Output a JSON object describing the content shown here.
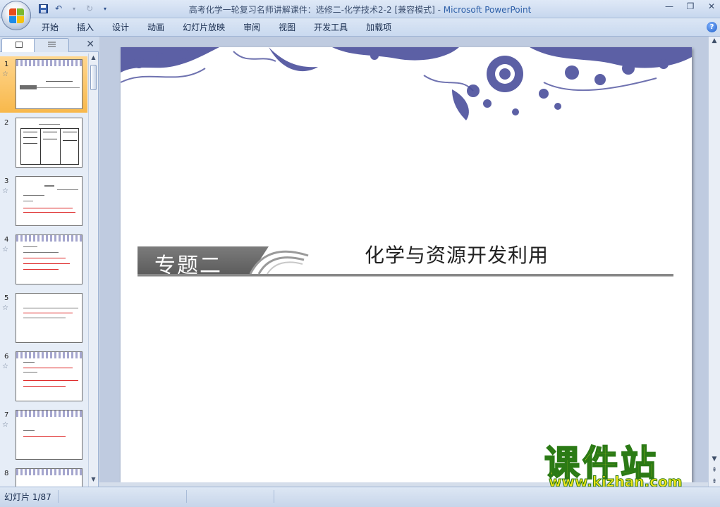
{
  "window": {
    "title": "高考化学一轮复习名师讲解课件：选修二-化学技术2-2 [兼容模式]",
    "title_sep": " - ",
    "app_name": "Microsoft PowerPoint"
  },
  "ribbon": {
    "tabs": [
      "开始",
      "插入",
      "设计",
      "动画",
      "幻灯片放映",
      "审阅",
      "视图",
      "开发工具",
      "加载项"
    ]
  },
  "slide_panel": {
    "close_glyph": "✕",
    "thumbnails": [
      {
        "number": "1",
        "active": true
      },
      {
        "number": "2",
        "active": false
      },
      {
        "number": "3",
        "active": false
      },
      {
        "number": "4",
        "active": false
      },
      {
        "number": "5",
        "active": false
      },
      {
        "number": "6",
        "active": false
      },
      {
        "number": "7",
        "active": false
      },
      {
        "number": "8",
        "active": false
      }
    ],
    "transition_marker": "☆"
  },
  "slide": {
    "banner_label": "专题二",
    "title": "化学与资源开发利用"
  },
  "watermark": {
    "name": "课件站",
    "url": "www.kjzhan.com"
  },
  "status": {
    "slide_indicator": "幻灯片 1/87"
  },
  "colors": {
    "accent": "#2d5fa8",
    "floral": "#4b4f9c",
    "banner": "#6d6d6d",
    "active_thumb": "#f8b84b"
  }
}
